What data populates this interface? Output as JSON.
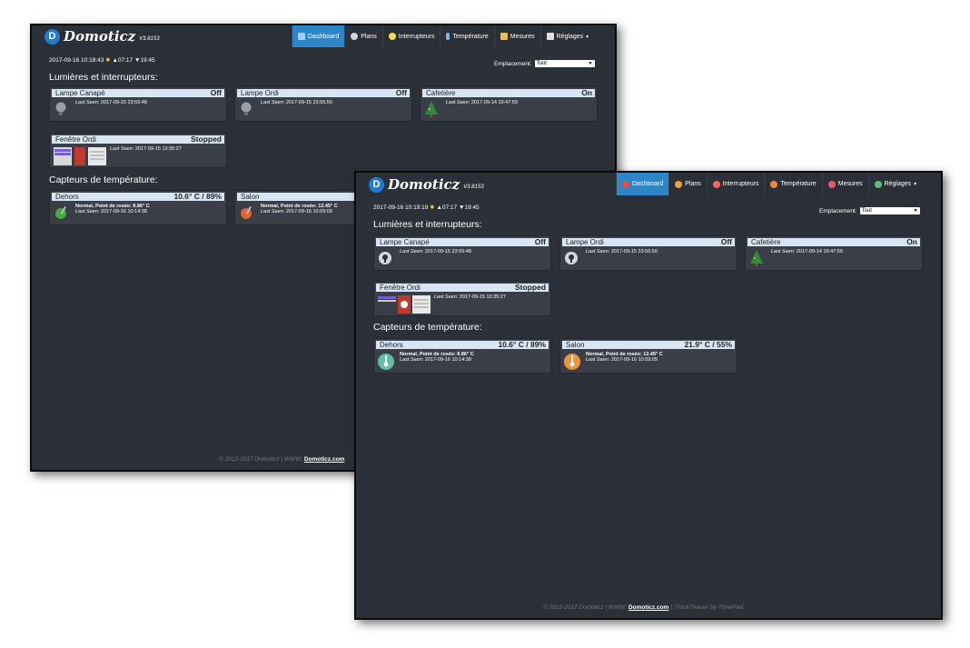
{
  "back": {
    "brand": {
      "name": "Domoticz",
      "version": "V3.8153"
    },
    "nav": [
      {
        "label": "Dashboard"
      },
      {
        "label": "Plans"
      },
      {
        "label": "Interrupteurs"
      },
      {
        "label": "Température"
      },
      {
        "label": "Mesures"
      },
      {
        "label": "Réglages",
        "caret": "▾"
      }
    ],
    "datetime": "2017-09-16 10:18:43",
    "sunrise": "▲07:17",
    "sunset": "▼19:45",
    "location_label": "Emplacement:",
    "location_value": "Tout",
    "section_lights": "Lumières et interrupteurs:",
    "section_temp": "Capteurs de température:",
    "lights": [
      {
        "name": "Lampe Canapé",
        "status": "Off",
        "seen_label": "Last Seen:",
        "seen": "2017-09-15 23:55:48"
      },
      {
        "name": "Lampe Ordi",
        "status": "Off",
        "seen_label": "Last Seen:",
        "seen": "2017-09-15 23:55:50"
      },
      {
        "name": "Cafetière",
        "status": "On",
        "seen_label": "Last Seen:",
        "seen": "2017-09-14 19:47:59"
      },
      {
        "name": "Fenêtre Ordi",
        "status": "Stopped",
        "seen_label": "Last Seen:",
        "seen": "2017-09-15 13:35:27"
      }
    ],
    "temps": [
      {
        "name": "Dehors",
        "status": "10.6° C / 89%",
        "info": "Normal, Point de rosée: 8.86° C",
        "seen_label": "Last Seen:",
        "seen": "2017-09-16 10:14:38"
      },
      {
        "name": "Salon",
        "status": "",
        "info": "Normal, Point de rosée: 12.45° C",
        "seen_label": "Last Seen:",
        "seen": "2017-09-16 10:09:09"
      }
    ],
    "footer": {
      "text": "© 2012-2017 Domoticz | WWW:",
      "link": "Domoticz.com"
    }
  },
  "front": {
    "brand": {
      "name": "Domoticz",
      "version": "V3.8153"
    },
    "nav": [
      {
        "label": "Dashboard"
      },
      {
        "label": "Plans"
      },
      {
        "label": "Interrupteurs"
      },
      {
        "label": "Température"
      },
      {
        "label": "Mesures"
      },
      {
        "label": "Réglages",
        "caret": "▾"
      }
    ],
    "datetime": "2017-09-16 10:19:19",
    "sunrise": "▲07:17",
    "sunset": "▼19:45",
    "location_label": "Emplacement:",
    "location_value": "Tout",
    "section_lights": "Lumières et interrupteurs:",
    "section_temp": "Capteurs de température:",
    "lights": [
      {
        "name": "Lampe Canapé",
        "status": "Off",
        "seen_label": "Last Seen:",
        "seen": "2017-09-15 23:55:48"
      },
      {
        "name": "Lampe Ordi",
        "status": "Off",
        "seen_label": "Last Seen:",
        "seen": "2017-09-15 23:55:50"
      },
      {
        "name": "Cafetière",
        "status": "On",
        "seen_label": "Last Seen:",
        "seen": "2017-09-14 19:47:59"
      },
      {
        "name": "Fenêtre Ordi",
        "status": "Stopped",
        "seen_label": "Last Seen:",
        "seen": "2017-09-15 13:35:27"
      }
    ],
    "temps": [
      {
        "name": "Dehors",
        "status": "10.6° C / 89%",
        "info": "Normal, Point de rosée: 8.86° C",
        "seen_label": "Last Seen:",
        "seen": "2017-09-16 10:14:38"
      },
      {
        "name": "Salon",
        "status": "21.9° C / 55%",
        "info": "Normal, Point de rosée: 12.45° C",
        "seen_label": "Last Seen:",
        "seen": "2017-09-16 10:09:09"
      }
    ],
    "footer": {
      "text": "© 2012-2017 Domoticz | WWW:",
      "link": "Domoticz.com",
      "theme": "| 'ThinkTheme' by ThinkPad"
    }
  },
  "colors": {
    "background": "#2c3039",
    "nav_active": "#2d86c8",
    "tile_header": "#d8e6f3",
    "tile_body": "#3a3e48"
  },
  "icons": {
    "back": [
      "lightbulb-icon",
      "christmas-tree-icon",
      "blinds-icon",
      "stop-icon",
      "thermometer-icon"
    ],
    "front": [
      "lightbulb-icon",
      "christmas-tree-icon",
      "blinds-icon",
      "stop-icon",
      "thermometer-icon"
    ]
  }
}
